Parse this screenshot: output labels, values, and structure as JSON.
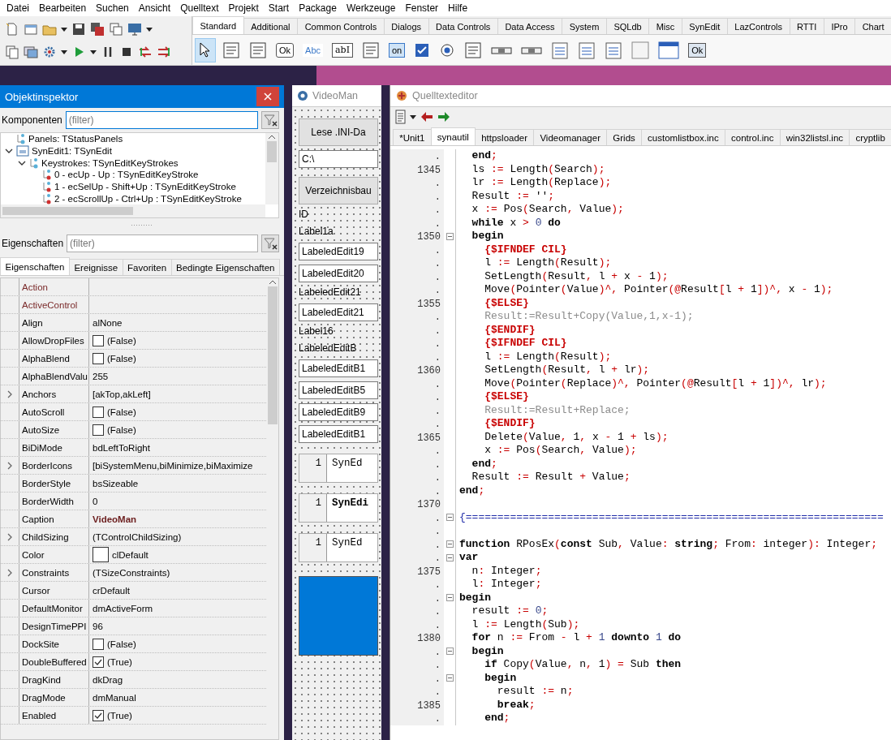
{
  "menu": [
    "Datei",
    "Bearbeiten",
    "Suchen",
    "Ansicht",
    "Quelltext",
    "Projekt",
    "Start",
    "Package",
    "Werkzeuge",
    "Fenster",
    "Hilfe"
  ],
  "palette": {
    "tabs": [
      {
        "label": "Standard",
        "selected": true
      },
      {
        "label": "Additional",
        "selected": false
      },
      {
        "label": "Common Controls",
        "selected": false
      },
      {
        "label": "Dialogs",
        "selected": false
      },
      {
        "label": "Data Controls",
        "selected": false
      },
      {
        "label": "Data Access",
        "selected": false
      },
      {
        "label": "System",
        "selected": false
      },
      {
        "label": "SQLdb",
        "selected": false
      },
      {
        "label": "Misc",
        "selected": false
      },
      {
        "label": "SynEdit",
        "selected": false
      },
      {
        "label": "LazControls",
        "selected": false
      },
      {
        "label": "RTTI",
        "selected": false
      },
      {
        "label": "IPro",
        "selected": false
      },
      {
        "label": "Chart",
        "selected": false
      }
    ],
    "items": [
      {
        "kind": "pointer",
        "selected": true
      },
      {
        "kind": "menu",
        "selected": false
      },
      {
        "kind": "popup",
        "selected": false
      },
      {
        "kind": "button",
        "label": "Ok",
        "selected": false
      },
      {
        "kind": "label",
        "label": "Abc",
        "selected": false
      },
      {
        "kind": "edit",
        "label": "abI",
        "selected": false
      },
      {
        "kind": "memo",
        "selected": false
      },
      {
        "kind": "toggle",
        "label": "on",
        "selected": false
      },
      {
        "kind": "check",
        "selected": false
      },
      {
        "kind": "radio",
        "selected": false
      },
      {
        "kind": "listbox",
        "selected": false
      },
      {
        "kind": "combobox",
        "selected": false
      },
      {
        "kind": "scrollbar",
        "selected": false
      },
      {
        "kind": "groupbox",
        "selected": false
      },
      {
        "kind": "radiogroup",
        "selected": false
      },
      {
        "kind": "checkgroup",
        "selected": false
      },
      {
        "kind": "panel",
        "selected": false
      },
      {
        "kind": "frame",
        "selected": false
      },
      {
        "kind": "dialog",
        "label": "Ok",
        "selected": false
      }
    ]
  },
  "inspector": {
    "title": "Objektinspektor",
    "components_label": "Komponenten",
    "components_filter": {
      "placeholder": "(filter)",
      "focused": true
    },
    "tree": [
      {
        "label": "Panels: TStatusPanels",
        "kind": "collection"
      },
      {
        "label": "SynEdit1: TSynEdit",
        "kind": "component",
        "expanded": true,
        "children": [
          {
            "label": "Keystrokes: TSynEditKeyStrokes",
            "kind": "collection",
            "expanded": true,
            "children": [
              {
                "label": "0 - ecUp - Up : TSynEditKeyStroke",
                "kind": "item"
              },
              {
                "label": "1 - ecSelUp - Shift+Up : TSynEditKeyStroke",
                "kind": "item"
              },
              {
                "label": "2 - ecScrollUp - Ctrl+Up : TSynEditKeyStroke",
                "kind": "item"
              }
            ]
          }
        ]
      }
    ],
    "properties_label": "Eigenschaften",
    "properties_filter": {
      "placeholder": "(filter)",
      "focused": false
    },
    "tabs": [
      {
        "label": "Eigenschaften",
        "selected": true
      },
      {
        "label": "Ereignisse",
        "selected": false
      },
      {
        "label": "Favoriten",
        "selected": false
      },
      {
        "label": "Bedingte Eigenschaften",
        "selected": false
      }
    ],
    "properties": [
      {
        "name": "Action",
        "kind": "none",
        "expandable": false,
        "reference": true
      },
      {
        "name": "ActiveControl",
        "kind": "none",
        "expandable": false,
        "reference": true
      },
      {
        "name": "Align",
        "value": "alNone",
        "kind": "text",
        "expandable": false,
        "reference": false,
        "modified": false
      },
      {
        "name": "AllowDropFiles",
        "value": "(False)",
        "kind": "check",
        "checked": false,
        "expandable": false,
        "reference": false,
        "modified": false
      },
      {
        "name": "AlphaBlend",
        "value": "(False)",
        "kind": "check",
        "checked": false,
        "expandable": false,
        "reference": false,
        "modified": false
      },
      {
        "name": "AlphaBlendValu",
        "value": "255",
        "kind": "text",
        "expandable": false,
        "reference": false,
        "modified": false
      },
      {
        "name": "Anchors",
        "value": "[akTop,akLeft]",
        "kind": "text",
        "expandable": true,
        "reference": false,
        "modified": false
      },
      {
        "name": "AutoScroll",
        "value": "(False)",
        "kind": "check",
        "checked": false,
        "expandable": false,
        "reference": false,
        "modified": false
      },
      {
        "name": "AutoSize",
        "value": "(False)",
        "kind": "check",
        "checked": false,
        "expandable": false,
        "reference": false,
        "modified": false
      },
      {
        "name": "BiDiMode",
        "value": "bdLeftToRight",
        "kind": "text",
        "expandable": false,
        "reference": false,
        "modified": false
      },
      {
        "name": "BorderIcons",
        "value": "[biSystemMenu,biMinimize,biMaximize",
        "kind": "text",
        "expandable": true,
        "reference": false,
        "modified": false
      },
      {
        "name": "BorderStyle",
        "value": "bsSizeable",
        "kind": "text",
        "expandable": false,
        "reference": false,
        "modified": false
      },
      {
        "name": "BorderWidth",
        "value": "0",
        "kind": "text",
        "expandable": false,
        "reference": false,
        "modified": false
      },
      {
        "name": "Caption",
        "value": "VideoMan",
        "kind": "text",
        "expandable": false,
        "reference": false,
        "modified": true
      },
      {
        "name": "ChildSizing",
        "value": "(TControlChildSizing)",
        "kind": "text",
        "expandable": true,
        "reference": false,
        "modified": false
      },
      {
        "name": "Color",
        "value": "clDefault",
        "kind": "color",
        "expandable": false,
        "reference": false,
        "modified": false
      },
      {
        "name": "Constraints",
        "value": "(TSizeConstraints)",
        "kind": "text",
        "expandable": true,
        "reference": false,
        "modified": false
      },
      {
        "name": "Cursor",
        "value": "crDefault",
        "kind": "text",
        "expandable": false,
        "reference": false,
        "modified": false
      },
      {
        "name": "DefaultMonitor",
        "value": "dmActiveForm",
        "kind": "text",
        "expandable": false,
        "reference": false,
        "modified": false
      },
      {
        "name": "DesignTimePPI",
        "value": "96",
        "kind": "text",
        "expandable": false,
        "reference": false,
        "modified": false
      },
      {
        "name": "DockSite",
        "value": "(False)",
        "kind": "check",
        "checked": false,
        "expandable": false,
        "reference": false,
        "modified": false
      },
      {
        "name": "DoubleBuffered",
        "value": "(True)",
        "kind": "check",
        "checked": true,
        "expandable": false,
        "reference": false,
        "modified": false
      },
      {
        "name": "DragKind",
        "value": "dkDrag",
        "kind": "text",
        "expandable": false,
        "reference": false,
        "modified": false
      },
      {
        "name": "DragMode",
        "value": "dmManual",
        "kind": "text",
        "expandable": false,
        "reference": false,
        "modified": false
      },
      {
        "name": "Enabled",
        "value": "(True)",
        "kind": "check",
        "checked": true,
        "expandable": false,
        "reference": false,
        "modified": false
      }
    ]
  },
  "designer": {
    "title": "VideoMan",
    "controls": [
      {
        "kind": "button",
        "text": "Lese .INI-Da"
      },
      {
        "kind": "edit",
        "text": "C:\\"
      },
      {
        "kind": "button",
        "text": "Verzeichnisbau"
      },
      {
        "kind": "label",
        "text": "ID"
      },
      {
        "kind": "label",
        "text": "Label1a"
      },
      {
        "kind": "edit",
        "text": "LabeledEdit19"
      },
      {
        "kind": "edit",
        "text": "LabeledEdit20"
      },
      {
        "kind": "label",
        "text": "LabeledEdit21"
      },
      {
        "kind": "edit",
        "text": "LabeledEdit21"
      },
      {
        "kind": "label",
        "text": "Label16"
      },
      {
        "kind": "label",
        "text": "LabeledEditB"
      },
      {
        "kind": "edit",
        "text": "LabeledEditB1"
      },
      {
        "kind": "edit",
        "text": "LabeledEditB5"
      },
      {
        "kind": "edit",
        "text": "LabeledEditB9"
      },
      {
        "kind": "edit",
        "text": "LabeledEditB1"
      },
      {
        "kind": "synedit",
        "number": "1",
        "text": "SynEd",
        "bold": false
      },
      {
        "kind": "synedit",
        "number": "1",
        "text": "SynEdi",
        "bold": true
      },
      {
        "kind": "synedit",
        "number": "1",
        "text": "SynEd",
        "bold": false
      },
      {
        "kind": "panel"
      }
    ]
  },
  "editor": {
    "title": "Quelltexteditor",
    "tabs": [
      {
        "label": "*Unit1",
        "selected": false
      },
      {
        "label": "synautil",
        "selected": true
      },
      {
        "label": "httpsloader",
        "selected": false
      },
      {
        "label": "Videomanager",
        "selected": false
      },
      {
        "label": "Grids",
        "selected": false
      },
      {
        "label": "customlistbox.inc",
        "selected": false
      },
      {
        "label": "control.inc",
        "selected": false
      },
      {
        "label": "win32listsl.inc",
        "selected": false
      },
      {
        "label": "cryptlib",
        "selected": false
      }
    ],
    "lines": [
      {
        "number": ".",
        "fold": false,
        "tokens": [
          {
            "kind": "keyword",
            "text": "  end"
          },
          {
            "kind": "symbol",
            "text": ";"
          }
        ]
      },
      {
        "number": "1345",
        "fold": false,
        "tokens": [
          {
            "kind": "plain",
            "text": "  ls "
          },
          {
            "kind": "symbol",
            "text": ":="
          },
          {
            "kind": "plain",
            "text": " Length"
          },
          {
            "kind": "symbol",
            "text": "("
          },
          {
            "kind": "plain",
            "text": "Search"
          },
          {
            "kind": "symbol",
            "text": ");"
          }
        ]
      },
      {
        "number": ".",
        "fold": false,
        "tokens": [
          {
            "kind": "plain",
            "text": "  lr "
          },
          {
            "kind": "symbol",
            "text": ":="
          },
          {
            "kind": "plain",
            "text": " Length"
          },
          {
            "kind": "symbol",
            "text": "("
          },
          {
            "kind": "plain",
            "text": "Replace"
          },
          {
            "kind": "symbol",
            "text": ");"
          }
        ]
      },
      {
        "number": ".",
        "fold": false,
        "tokens": [
          {
            "kind": "plain",
            "text": "  Result "
          },
          {
            "kind": "symbol",
            "text": ":="
          },
          {
            "kind": "plain",
            "text": " ''"
          },
          {
            "kind": "symbol",
            "text": ";"
          }
        ]
      },
      {
        "number": ".",
        "fold": false,
        "tokens": [
          {
            "kind": "plain",
            "text": "  x "
          },
          {
            "kind": "symbol",
            "text": ":="
          },
          {
            "kind": "plain",
            "text": " Pos"
          },
          {
            "kind": "symbol",
            "text": "("
          },
          {
            "kind": "plain",
            "text": "Search"
          },
          {
            "kind": "symbol",
            "text": ","
          },
          {
            "kind": "plain",
            "text": " Value"
          },
          {
            "kind": "symbol",
            "text": ");"
          }
        ]
      },
      {
        "number": ".",
        "fold": false,
        "tokens": [
          {
            "kind": "keyword",
            "text": "  while"
          },
          {
            "kind": "plain",
            "text": " x "
          },
          {
            "kind": "symbol",
            "text": ">"
          },
          {
            "kind": "number",
            "text": " 0"
          },
          {
            "kind": "keyword",
            "text": " do"
          }
        ]
      },
      {
        "number": "1350",
        "fold": true,
        "tokens": [
          {
            "kind": "keyword",
            "text": "  begin"
          }
        ]
      },
      {
        "number": ".",
        "fold": false,
        "tokens": [
          {
            "kind": "directive",
            "text": "    {$IFNDEF CIL}"
          }
        ]
      },
      {
        "number": ".",
        "fold": false,
        "tokens": [
          {
            "kind": "plain",
            "text": "    l "
          },
          {
            "kind": "symbol",
            "text": ":="
          },
          {
            "kind": "plain",
            "text": " Length"
          },
          {
            "kind": "symbol",
            "text": "("
          },
          {
            "kind": "plain",
            "text": "Result"
          },
          {
            "kind": "symbol",
            "text": ");"
          }
        ]
      },
      {
        "number": ".",
        "fold": false,
        "tokens": [
          {
            "kind": "plain",
            "text": "    SetLength"
          },
          {
            "kind": "symbol",
            "text": "("
          },
          {
            "kind": "plain",
            "text": "Result"
          },
          {
            "kind": "symbol",
            "text": ","
          },
          {
            "kind": "plain",
            "text": " l "
          },
          {
            "kind": "symbol",
            "text": "+"
          },
          {
            "kind": "plain",
            "text": " x "
          },
          {
            "kind": "symbol",
            "text": "-"
          },
          {
            "kind": "plain",
            "text": " 1"
          },
          {
            "kind": "symbol",
            "text": ");"
          }
        ]
      },
      {
        "number": ".",
        "fold": false,
        "tokens": [
          {
            "kind": "plain",
            "text": "    Move"
          },
          {
            "kind": "symbol",
            "text": "("
          },
          {
            "kind": "plain",
            "text": "Pointer"
          },
          {
            "kind": "symbol",
            "text": "("
          },
          {
            "kind": "plain",
            "text": "Value"
          },
          {
            "kind": "symbol",
            "text": ")^,"
          },
          {
            "kind": "plain",
            "text": " Pointer"
          },
          {
            "kind": "symbol",
            "text": "(@"
          },
          {
            "kind": "plain",
            "text": "Result"
          },
          {
            "kind": "symbol",
            "text": "["
          },
          {
            "kind": "plain",
            "text": "l "
          },
          {
            "kind": "symbol",
            "text": "+"
          },
          {
            "kind": "plain",
            "text": " 1"
          },
          {
            "kind": "symbol",
            "text": "])^,"
          },
          {
            "kind": "plain",
            "text": " x "
          },
          {
            "kind": "symbol",
            "text": "-"
          },
          {
            "kind": "plain",
            "text": " 1"
          },
          {
            "kind": "symbol",
            "text": ");"
          }
        ]
      },
      {
        "number": "1355",
        "fold": false,
        "tokens": [
          {
            "kind": "directive",
            "text": "    {$ELSE}"
          }
        ]
      },
      {
        "number": ".",
        "fold": false,
        "tokens": [
          {
            "kind": "inactive",
            "text": "    Result:=Result+Copy(Value,1,x-1);"
          }
        ]
      },
      {
        "number": ".",
        "fold": false,
        "tokens": [
          {
            "kind": "directive",
            "text": "    {$ENDIF}"
          }
        ]
      },
      {
        "number": ".",
        "fold": false,
        "tokens": [
          {
            "kind": "directive",
            "text": "    {$IFNDEF CIL}"
          }
        ]
      },
      {
        "number": ".",
        "fold": false,
        "tokens": [
          {
            "kind": "plain",
            "text": "    l "
          },
          {
            "kind": "symbol",
            "text": ":="
          },
          {
            "kind": "plain",
            "text": " Length"
          },
          {
            "kind": "symbol",
            "text": "("
          },
          {
            "kind": "plain",
            "text": "Result"
          },
          {
            "kind": "symbol",
            "text": ");"
          }
        ]
      },
      {
        "number": "1360",
        "fold": false,
        "tokens": [
          {
            "kind": "plain",
            "text": "    SetLength"
          },
          {
            "kind": "symbol",
            "text": "("
          },
          {
            "kind": "plain",
            "text": "Result"
          },
          {
            "kind": "symbol",
            "text": ","
          },
          {
            "kind": "plain",
            "text": " l "
          },
          {
            "kind": "symbol",
            "text": "+"
          },
          {
            "kind": "plain",
            "text": " lr"
          },
          {
            "kind": "symbol",
            "text": ");"
          }
        ]
      },
      {
        "number": ".",
        "fold": false,
        "tokens": [
          {
            "kind": "plain",
            "text": "    Move"
          },
          {
            "kind": "symbol",
            "text": "("
          },
          {
            "kind": "plain",
            "text": "Pointer"
          },
          {
            "kind": "symbol",
            "text": "("
          },
          {
            "kind": "plain",
            "text": "Replace"
          },
          {
            "kind": "symbol",
            "text": ")^,"
          },
          {
            "kind": "plain",
            "text": " Pointer"
          },
          {
            "kind": "symbol",
            "text": "(@"
          },
          {
            "kind": "plain",
            "text": "Result"
          },
          {
            "kind": "symbol",
            "text": "["
          },
          {
            "kind": "plain",
            "text": "l "
          },
          {
            "kind": "symbol",
            "text": "+"
          },
          {
            "kind": "plain",
            "text": " 1"
          },
          {
            "kind": "symbol",
            "text": "])^,"
          },
          {
            "kind": "plain",
            "text": " lr"
          },
          {
            "kind": "symbol",
            "text": ");"
          }
        ]
      },
      {
        "number": ".",
        "fold": false,
        "tokens": [
          {
            "kind": "directive",
            "text": "    {$ELSE}"
          }
        ]
      },
      {
        "number": ".",
        "fold": false,
        "tokens": [
          {
            "kind": "inactive",
            "text": "    Result:=Result+Replace;"
          }
        ]
      },
      {
        "number": ".",
        "fold": false,
        "tokens": [
          {
            "kind": "directive",
            "text": "    {$ENDIF}"
          }
        ]
      },
      {
        "number": "1365",
        "fold": false,
        "tokens": [
          {
            "kind": "plain",
            "text": "    Delete"
          },
          {
            "kind": "symbol",
            "text": "("
          },
          {
            "kind": "plain",
            "text": "Value"
          },
          {
            "kind": "symbol",
            "text": ","
          },
          {
            "kind": "plain",
            "text": " 1"
          },
          {
            "kind": "symbol",
            "text": ","
          },
          {
            "kind": "plain",
            "text": " x "
          },
          {
            "kind": "symbol",
            "text": "-"
          },
          {
            "kind": "plain",
            "text": " 1 "
          },
          {
            "kind": "symbol",
            "text": "+"
          },
          {
            "kind": "plain",
            "text": " ls"
          },
          {
            "kind": "symbol",
            "text": ");"
          }
        ]
      },
      {
        "number": ".",
        "fold": false,
        "tokens": [
          {
            "kind": "plain",
            "text": "    x "
          },
          {
            "kind": "symbol",
            "text": ":="
          },
          {
            "kind": "plain",
            "text": " Pos"
          },
          {
            "kind": "symbol",
            "text": "("
          },
          {
            "kind": "plain",
            "text": "Search"
          },
          {
            "kind": "symbol",
            "text": ","
          },
          {
            "kind": "plain",
            "text": " Value"
          },
          {
            "kind": "symbol",
            "text": ");"
          }
        ]
      },
      {
        "number": ".",
        "fold": false,
        "tokens": [
          {
            "kind": "keyword",
            "text": "  end"
          },
          {
            "kind": "symbol",
            "text": ";"
          }
        ]
      },
      {
        "number": ".",
        "fold": false,
        "tokens": [
          {
            "kind": "plain",
            "text": "  Result "
          },
          {
            "kind": "symbol",
            "text": ":="
          },
          {
            "kind": "plain",
            "text": " Result "
          },
          {
            "kind": "symbol",
            "text": "+"
          },
          {
            "kind": "plain",
            "text": " Value"
          },
          {
            "kind": "symbol",
            "text": ";"
          }
        ]
      },
      {
        "number": ".",
        "fold": false,
        "tokens": [
          {
            "kind": "keyword",
            "text": "end"
          },
          {
            "kind": "symbol",
            "text": ";"
          }
        ]
      },
      {
        "number": "1370",
        "fold": false
      },
      {
        "number": ".",
        "fold": true,
        "tokens": [
          {
            "kind": "comment",
            "text": "{=================================================================="
          }
        ]
      },
      {
        "number": ".",
        "fold": false
      },
      {
        "number": ".",
        "fold": true,
        "tokens": [
          {
            "kind": "keyword",
            "text": "function"
          },
          {
            "kind": "plain",
            "text": " RPosEx"
          },
          {
            "kind": "symbol",
            "text": "("
          },
          {
            "kind": "keyword",
            "text": "const"
          },
          {
            "kind": "plain",
            "text": " Sub"
          },
          {
            "kind": "symbol",
            "text": ","
          },
          {
            "kind": "plain",
            "text": " Value"
          },
          {
            "kind": "symbol",
            "text": ":"
          },
          {
            "kind": "keyword",
            "text": " string"
          },
          {
            "kind": "symbol",
            "text": ";"
          },
          {
            "kind": "plain",
            "text": " From"
          },
          {
            "kind": "symbol",
            "text": ":"
          },
          {
            "kind": "plain",
            "text": " integer"
          },
          {
            "kind": "symbol",
            "text": "):"
          },
          {
            "kind": "plain",
            "text": " Integer"
          },
          {
            "kind": "symbol",
            "text": ";"
          }
        ]
      },
      {
        "number": ".",
        "fold": true,
        "tokens": [
          {
            "kind": "keyword",
            "text": "var"
          }
        ]
      },
      {
        "number": "1375",
        "fold": false,
        "tokens": [
          {
            "kind": "plain",
            "text": "  n"
          },
          {
            "kind": "symbol",
            "text": ":"
          },
          {
            "kind": "plain",
            "text": " Integer"
          },
          {
            "kind": "symbol",
            "text": ";"
          }
        ]
      },
      {
        "number": ".",
        "fold": false,
        "tokens": [
          {
            "kind": "plain",
            "text": "  l"
          },
          {
            "kind": "symbol",
            "text": ":"
          },
          {
            "kind": "plain",
            "text": " Integer"
          },
          {
            "kind": "symbol",
            "text": ";"
          }
        ]
      },
      {
        "number": ".",
        "fold": true,
        "tokens": [
          {
            "kind": "keyword",
            "text": "begin"
          }
        ]
      },
      {
        "number": ".",
        "fold": false,
        "tokens": [
          {
            "kind": "plain",
            "text": "  result "
          },
          {
            "kind": "symbol",
            "text": ":="
          },
          {
            "kind": "number",
            "text": " 0"
          },
          {
            "kind": "symbol",
            "text": ";"
          }
        ]
      },
      {
        "number": ".",
        "fold": false,
        "tokens": [
          {
            "kind": "plain",
            "text": "  l "
          },
          {
            "kind": "symbol",
            "text": ":="
          },
          {
            "kind": "plain",
            "text": " Length"
          },
          {
            "kind": "symbol",
            "text": "("
          },
          {
            "kind": "plain",
            "text": "Sub"
          },
          {
            "kind": "symbol",
            "text": ");"
          }
        ]
      },
      {
        "number": "1380",
        "fold": false,
        "tokens": [
          {
            "kind": "keyword",
            "text": "  for"
          },
          {
            "kind": "plain",
            "text": " n "
          },
          {
            "kind": "symbol",
            "text": ":="
          },
          {
            "kind": "plain",
            "text": " From "
          },
          {
            "kind": "symbol",
            "text": "-"
          },
          {
            "kind": "plain",
            "text": " l "
          },
          {
            "kind": "symbol",
            "text": "+"
          },
          {
            "kind": "number",
            "text": " 1"
          },
          {
            "kind": "keyword",
            "text": " downto"
          },
          {
            "kind": "number",
            "text": " 1"
          },
          {
            "kind": "keyword",
            "text": " do"
          }
        ]
      },
      {
        "number": ".",
        "fold": true,
        "tokens": [
          {
            "kind": "keyword",
            "text": "  begin"
          }
        ]
      },
      {
        "number": ".",
        "fold": false,
        "tokens": [
          {
            "kind": "keyword",
            "text": "    if"
          },
          {
            "kind": "plain",
            "text": " Copy"
          },
          {
            "kind": "symbol",
            "text": "("
          },
          {
            "kind": "plain",
            "text": "Value"
          },
          {
            "kind": "symbol",
            "text": ","
          },
          {
            "kind": "plain",
            "text": " n"
          },
          {
            "kind": "symbol",
            "text": ","
          },
          {
            "kind": "plain",
            "text": " 1"
          },
          {
            "kind": "symbol",
            "text": ")"
          },
          {
            "kind": "symbol",
            "text": " ="
          },
          {
            "kind": "plain",
            "text": " Sub"
          },
          {
            "kind": "keyword",
            "text": " then"
          }
        ]
      },
      {
        "number": ".",
        "fold": true,
        "tokens": [
          {
            "kind": "keyword",
            "text": "    begin"
          }
        ]
      },
      {
        "number": ".",
        "fold": false,
        "tokens": [
          {
            "kind": "plain",
            "text": "      result "
          },
          {
            "kind": "symbol",
            "text": ":="
          },
          {
            "kind": "plain",
            "text": " n"
          },
          {
            "kind": "symbol",
            "text": ";"
          }
        ]
      },
      {
        "number": "1385",
        "fold": false,
        "tokens": [
          {
            "kind": "keyword",
            "text": "      break"
          },
          {
            "kind": "symbol",
            "text": ";"
          }
        ]
      },
      {
        "number": ".",
        "fold": false,
        "tokens": [
          {
            "kind": "keyword",
            "text": "    end"
          },
          {
            "kind": "symbol",
            "text": ";"
          }
        ]
      }
    ]
  }
}
